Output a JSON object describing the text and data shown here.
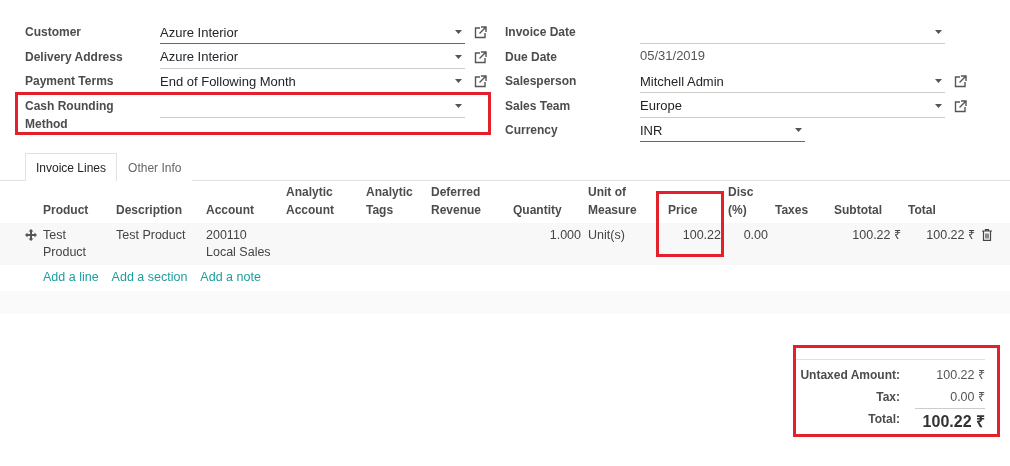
{
  "left_fields": [
    {
      "label": "Customer",
      "kind": "link_select",
      "value": "Azure Interior",
      "required": true,
      "highlighted": false
    },
    {
      "label": "Delivery Address",
      "kind": "link_select",
      "value": "Azure Interior",
      "required": false,
      "highlighted": false
    },
    {
      "label": "Payment Terms",
      "kind": "link_select",
      "value": "End of Following Month",
      "required": false,
      "highlighted": false
    },
    {
      "label": "Cash Rounding Method",
      "kind": "select",
      "required": false,
      "highlighted": true
    }
  ],
  "right_fields": [
    {
      "label": "Invoice Date",
      "kind": "select",
      "required": false,
      "highlighted": false
    },
    {
      "label": "Due Date",
      "kind": "text",
      "value": "05/31/2019",
      "highlighted": false
    },
    {
      "label": "Salesperson",
      "kind": "link_select",
      "value": "Mitchell Admin",
      "required": false,
      "highlighted": false
    },
    {
      "label": "Sales Team",
      "kind": "link_select",
      "value": "Europe",
      "required": false,
      "highlighted": false
    },
    {
      "label": "Currency",
      "kind": "short_select",
      "value": "INR",
      "required": true,
      "highlighted": false
    }
  ],
  "tabs": [
    {
      "label": "Invoice Lines",
      "selected": true
    },
    {
      "label": "Other Info",
      "selected": false
    }
  ],
  "columns": [
    {
      "label": "Product",
      "kind": "text",
      "highlighted": false
    },
    {
      "label": "Description",
      "kind": "text",
      "highlighted": false
    },
    {
      "label": "Account",
      "kind": "text",
      "highlighted": false
    },
    {
      "label": "Analytic Account",
      "kind": "text",
      "highlighted": false
    },
    {
      "label": "Analytic Tags",
      "kind": "text",
      "highlighted": false
    },
    {
      "label": "Deferred Revenue",
      "kind": "text",
      "highlighted": false
    },
    {
      "label": "Quantity",
      "kind": "number",
      "highlighted": false
    },
    {
      "label": "Unit of Measure",
      "kind": "text",
      "highlighted": false
    },
    {
      "label": "Price",
      "kind": "number",
      "highlighted": true
    },
    {
      "label": "Disc (%)",
      "kind": "number",
      "highlighted": false
    },
    {
      "label": "Taxes",
      "kind": "text",
      "highlighted": false
    },
    {
      "label": "Subtotal",
      "kind": "number",
      "highlighted": false
    },
    {
      "label": "Total",
      "kind": "number",
      "highlighted": false
    }
  ],
  "rows": [
    {
      "product": "Test\nProduct",
      "description": "Test Product",
      "account": "200110\nLocal Sales",
      "quantity": "1.000",
      "unit": "Unit(s)",
      "price": "100.22",
      "discount": "0.00",
      "subtotal": "100.22 ₹",
      "total": "100.22 ₹"
    }
  ],
  "add_links": [
    "Add a line",
    "Add a section",
    "Add a note"
  ],
  "totals": {
    "highlighted": true,
    "lines": [
      {
        "kind": "normal",
        "label": "Untaxed Amount:",
        "value": "100.22 ₹"
      },
      {
        "kind": "normal",
        "label": "Tax:",
        "value": "0.00 ₹"
      },
      {
        "kind": "grand",
        "label": "Total:",
        "value": "100.22 ₹"
      }
    ]
  }
}
